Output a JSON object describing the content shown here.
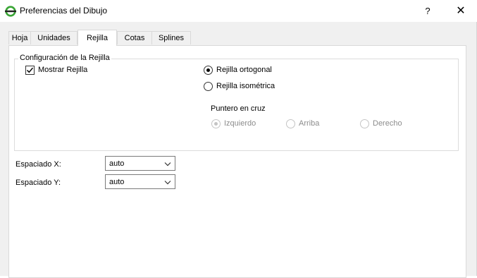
{
  "window": {
    "title": "Preferencias del Dibujo",
    "help_label": "?",
    "close_label": "✕"
  },
  "tabs": [
    {
      "label": "Hoja"
    },
    {
      "label": "Unidades"
    },
    {
      "label": "Rejilla",
      "active": true
    },
    {
      "label": "Cotas"
    },
    {
      "label": "Splines"
    }
  ],
  "grid_config": {
    "group_title": "Configuración de la Rejilla",
    "show_grid_label": "Mostrar Rejilla",
    "show_grid_checked": true,
    "orthogonal_label": "Rejilla ortogonal",
    "orthogonal_selected": true,
    "isometric_label": "Rejilla isométrica",
    "isometric_selected": false,
    "crosshair_title": "Puntero en cruz",
    "crosshair_options": [
      {
        "label": "Izquierdo",
        "selected": true,
        "enabled": false
      },
      {
        "label": "Arriba",
        "selected": false,
        "enabled": false
      },
      {
        "label": "Derecho",
        "selected": false,
        "enabled": false
      }
    ]
  },
  "spacing": {
    "x_label": "Espaciado X:",
    "x_value": "auto",
    "y_label": "Espaciado Y:",
    "y_value": "auto"
  },
  "colors": {
    "app_icon_green": "#3aa535",
    "border": "#d9d9d9",
    "background": "#f0f0f0"
  }
}
